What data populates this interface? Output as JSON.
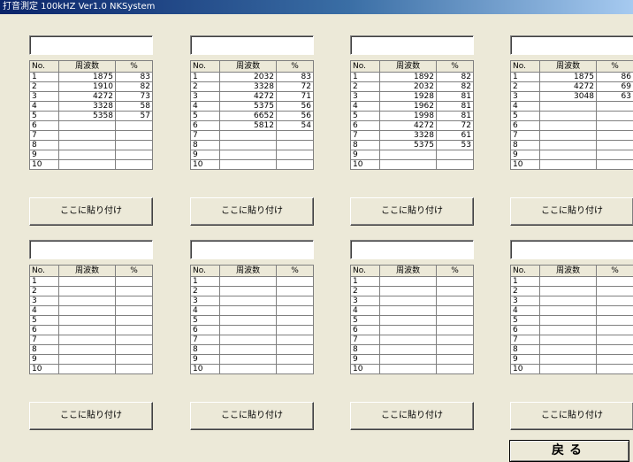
{
  "window": {
    "title": "打音測定 100kHZ  Ver1.0  NKSystem"
  },
  "common": {
    "col_no": "No.",
    "col_freq": "周波数",
    "col_pct": "%",
    "paste_label": "ここに貼り付け"
  },
  "back_label": "戻る",
  "panels": [
    {
      "input_value": "",
      "rows": [
        {
          "no": "1",
          "freq": "1875",
          "pct": "83"
        },
        {
          "no": "2",
          "freq": "1910",
          "pct": "82"
        },
        {
          "no": "3",
          "freq": "4272",
          "pct": "73"
        },
        {
          "no": "4",
          "freq": "3328",
          "pct": "58"
        },
        {
          "no": "5",
          "freq": "5358",
          "pct": "57"
        },
        {
          "no": "6",
          "freq": "",
          "pct": ""
        },
        {
          "no": "7",
          "freq": "",
          "pct": ""
        },
        {
          "no": "8",
          "freq": "",
          "pct": ""
        },
        {
          "no": "9",
          "freq": "",
          "pct": ""
        },
        {
          "no": "10",
          "freq": "",
          "pct": ""
        }
      ]
    },
    {
      "input_value": "",
      "rows": [
        {
          "no": "1",
          "freq": "2032",
          "pct": "83"
        },
        {
          "no": "2",
          "freq": "3328",
          "pct": "72"
        },
        {
          "no": "3",
          "freq": "4272",
          "pct": "71"
        },
        {
          "no": "4",
          "freq": "5375",
          "pct": "56"
        },
        {
          "no": "5",
          "freq": "6652",
          "pct": "56"
        },
        {
          "no": "6",
          "freq": "5812",
          "pct": "54"
        },
        {
          "no": "7",
          "freq": "",
          "pct": ""
        },
        {
          "no": "8",
          "freq": "",
          "pct": ""
        },
        {
          "no": "9",
          "freq": "",
          "pct": ""
        },
        {
          "no": "10",
          "freq": "",
          "pct": ""
        }
      ]
    },
    {
      "input_value": "",
      "rows": [
        {
          "no": "1",
          "freq": "1892",
          "pct": "82"
        },
        {
          "no": "2",
          "freq": "2032",
          "pct": "82"
        },
        {
          "no": "3",
          "freq": "1928",
          "pct": "81"
        },
        {
          "no": "4",
          "freq": "1962",
          "pct": "81"
        },
        {
          "no": "5",
          "freq": "1998",
          "pct": "81"
        },
        {
          "no": "6",
          "freq": "4272",
          "pct": "72"
        },
        {
          "no": "7",
          "freq": "3328",
          "pct": "61"
        },
        {
          "no": "8",
          "freq": "5375",
          "pct": "53"
        },
        {
          "no": "9",
          "freq": "",
          "pct": ""
        },
        {
          "no": "10",
          "freq": "",
          "pct": ""
        }
      ]
    },
    {
      "input_value": "",
      "rows": [
        {
          "no": "1",
          "freq": "1875",
          "pct": "86"
        },
        {
          "no": "2",
          "freq": "4272",
          "pct": "69"
        },
        {
          "no": "3",
          "freq": "3048",
          "pct": "63"
        },
        {
          "no": "4",
          "freq": "",
          "pct": ""
        },
        {
          "no": "5",
          "freq": "",
          "pct": ""
        },
        {
          "no": "6",
          "freq": "",
          "pct": ""
        },
        {
          "no": "7",
          "freq": "",
          "pct": ""
        },
        {
          "no": "8",
          "freq": "",
          "pct": ""
        },
        {
          "no": "9",
          "freq": "",
          "pct": ""
        },
        {
          "no": "10",
          "freq": "",
          "pct": ""
        }
      ]
    },
    {
      "input_value": "",
      "rows": [
        {
          "no": "1",
          "freq": "",
          "pct": ""
        },
        {
          "no": "2",
          "freq": "",
          "pct": ""
        },
        {
          "no": "3",
          "freq": "",
          "pct": ""
        },
        {
          "no": "4",
          "freq": "",
          "pct": ""
        },
        {
          "no": "5",
          "freq": "",
          "pct": ""
        },
        {
          "no": "6",
          "freq": "",
          "pct": ""
        },
        {
          "no": "7",
          "freq": "",
          "pct": ""
        },
        {
          "no": "8",
          "freq": "",
          "pct": ""
        },
        {
          "no": "9",
          "freq": "",
          "pct": ""
        },
        {
          "no": "10",
          "freq": "",
          "pct": ""
        }
      ]
    },
    {
      "input_value": "",
      "rows": [
        {
          "no": "1",
          "freq": "",
          "pct": ""
        },
        {
          "no": "2",
          "freq": "",
          "pct": ""
        },
        {
          "no": "3",
          "freq": "",
          "pct": ""
        },
        {
          "no": "4",
          "freq": "",
          "pct": ""
        },
        {
          "no": "5",
          "freq": "",
          "pct": ""
        },
        {
          "no": "6",
          "freq": "",
          "pct": ""
        },
        {
          "no": "7",
          "freq": "",
          "pct": ""
        },
        {
          "no": "8",
          "freq": "",
          "pct": ""
        },
        {
          "no": "9",
          "freq": "",
          "pct": ""
        },
        {
          "no": "10",
          "freq": "",
          "pct": ""
        }
      ]
    },
    {
      "input_value": "",
      "rows": [
        {
          "no": "1",
          "freq": "",
          "pct": ""
        },
        {
          "no": "2",
          "freq": "",
          "pct": ""
        },
        {
          "no": "3",
          "freq": "",
          "pct": ""
        },
        {
          "no": "4",
          "freq": "",
          "pct": ""
        },
        {
          "no": "5",
          "freq": "",
          "pct": ""
        },
        {
          "no": "6",
          "freq": "",
          "pct": ""
        },
        {
          "no": "7",
          "freq": "",
          "pct": ""
        },
        {
          "no": "8",
          "freq": "",
          "pct": ""
        },
        {
          "no": "9",
          "freq": "",
          "pct": ""
        },
        {
          "no": "10",
          "freq": "",
          "pct": ""
        }
      ]
    },
    {
      "input_value": "",
      "rows": [
        {
          "no": "1",
          "freq": "",
          "pct": ""
        },
        {
          "no": "2",
          "freq": "",
          "pct": ""
        },
        {
          "no": "3",
          "freq": "",
          "pct": ""
        },
        {
          "no": "4",
          "freq": "",
          "pct": ""
        },
        {
          "no": "5",
          "freq": "",
          "pct": ""
        },
        {
          "no": "6",
          "freq": "",
          "pct": ""
        },
        {
          "no": "7",
          "freq": "",
          "pct": ""
        },
        {
          "no": "8",
          "freq": "",
          "pct": ""
        },
        {
          "no": "9",
          "freq": "",
          "pct": ""
        },
        {
          "no": "10",
          "freq": "",
          "pct": ""
        }
      ]
    }
  ]
}
